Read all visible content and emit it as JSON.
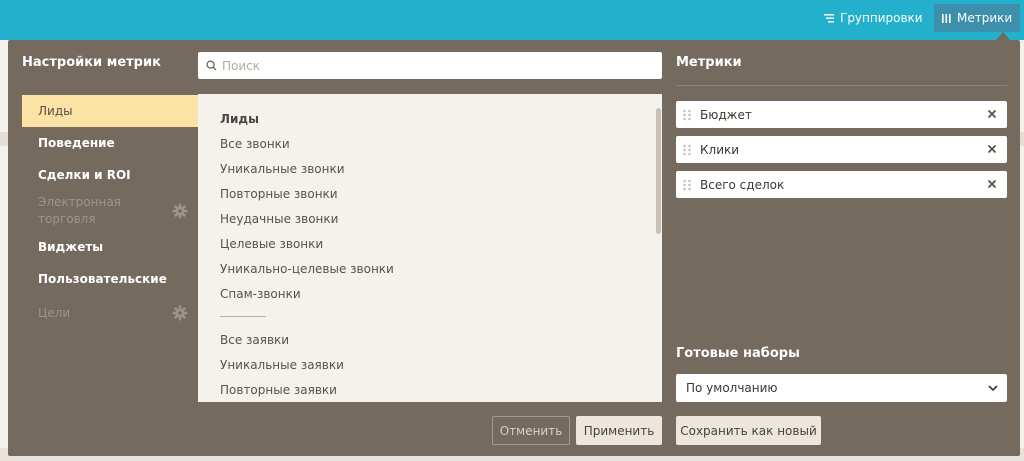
{
  "topbar": {
    "grouping_label": "Группировки",
    "metrics_label": "Метрики",
    "colors": {
      "bar": "#23b0cd",
      "active_button": "#3c90ab"
    }
  },
  "panel": {
    "title": "Настройки метрик",
    "background": "#746a5e"
  },
  "search": {
    "placeholder": "Поиск",
    "value": ""
  },
  "nav": {
    "items": [
      {
        "label": "Лиды",
        "state": "active"
      },
      {
        "label": "Поведение",
        "state": "normal"
      },
      {
        "label": "Сделки и ROI",
        "state": "normal"
      },
      {
        "label": "Электронная торговля",
        "state": "disabled",
        "icon": "gear-icon"
      },
      {
        "label": "Виджеты",
        "state": "normal"
      },
      {
        "label": "Пользовательские",
        "state": "normal"
      },
      {
        "label": "Цели",
        "state": "disabled",
        "icon": "gear-icon"
      }
    ]
  },
  "list": {
    "group_header": "Лиды",
    "items_a": [
      "Все звонки",
      "Уникальные звонки",
      "Повторные звонки",
      "Неудачные звонки",
      "Целевые звонки",
      "Уникально-целевые звонки",
      "Спам-звонки"
    ],
    "items_b": [
      "Все заявки",
      "Уникальные заявки",
      "Повторные заявки"
    ]
  },
  "metrics": {
    "title": "Метрики",
    "selected": [
      "Бюджет",
      "Клики",
      "Всего сделок"
    ]
  },
  "presets": {
    "title": "Готовые наборы",
    "selected": "По умолчанию"
  },
  "buttons": {
    "cancel": "Отменить",
    "apply": "Применить",
    "save_new": "Сохранить как новый"
  }
}
